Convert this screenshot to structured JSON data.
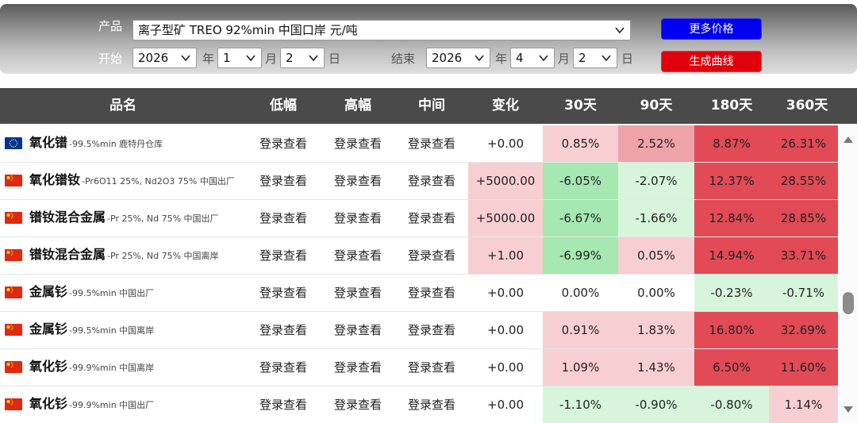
{
  "filters": {
    "product_label": "产品",
    "product_value": "离子型矿 TREO 92%min 中国口岸 元/吨",
    "start_label": "开始",
    "end_label": "结束",
    "year_unit": "年",
    "month_unit": "月",
    "day_unit": "日",
    "start_year": "2026",
    "start_month": "1",
    "start_day": "2",
    "end_year": "2026",
    "end_month": "4",
    "end_day": "2",
    "more_prices_button": "更多价格",
    "generate_curve_button": "生成曲线"
  },
  "table": {
    "headers": [
      "品名",
      "低幅",
      "高幅",
      "中间",
      "变化",
      "30天",
      "90天",
      "180天",
      "360天"
    ],
    "rows": [
      {
        "flag": "eu-flag",
        "name": "氧化镨",
        "spec": "-99.5%min 鹿特丹仓库",
        "low": "登录查看",
        "high": "登录查看",
        "mid": "登录查看",
        "change": "+0.00",
        "d30": "0.85%",
        "d90": "2.52%",
        "d180": "8.87%",
        "d360": "26.31%"
      },
      {
        "flag": "cn-flag",
        "name": "氧化镨钕",
        "spec": "-Pr6O11 25%, Nd2O3 75% 中国出厂",
        "low": "登录查看",
        "high": "登录查看",
        "mid": "登录查看",
        "change": "+5000.00",
        "d30": "-6.05%",
        "d90": "-2.07%",
        "d180": "12.37%",
        "d360": "28.55%"
      },
      {
        "flag": "cn-flag",
        "name": "镨钕混合金属",
        "spec": "-Pr 25%, Nd 75% 中国出厂",
        "low": "登录查看",
        "high": "登录查看",
        "mid": "登录查看",
        "change": "+5000.00",
        "d30": "-6.67%",
        "d90": "-1.66%",
        "d180": "12.84%",
        "d360": "28.85%"
      },
      {
        "flag": "cn-flag",
        "name": "镨钕混合金属",
        "spec": "-Pr 25%, Nd 75% 中国离岸",
        "low": "登录查看",
        "high": "登录查看",
        "mid": "登录查看",
        "change": "+1.00",
        "d30": "-6.99%",
        "d90": "0.05%",
        "d180": "14.94%",
        "d360": "33.71%"
      },
      {
        "flag": "cn-flag",
        "name": "金属钐",
        "spec": "-99.5%min 中国出厂",
        "low": "登录查看",
        "high": "登录查看",
        "mid": "登录查看",
        "change": "+0.00",
        "d30": "0.00%",
        "d90": "0.00%",
        "d180": "-0.23%",
        "d360": "-0.71%"
      },
      {
        "flag": "cn-flag",
        "name": "金属钐",
        "spec": "-99.5%min 中国离岸",
        "low": "登录查看",
        "high": "登录查看",
        "mid": "登录查看",
        "change": "+0.00",
        "d30": "0.91%",
        "d90": "1.83%",
        "d180": "16.80%",
        "d360": "32.69%"
      },
      {
        "flag": "cn-flag",
        "name": "氧化钐",
        "spec": "-99.9%min 中国离岸",
        "low": "登录查看",
        "high": "登录查看",
        "mid": "登录查看",
        "change": "+0.00",
        "d30": "1.09%",
        "d90": "1.43%",
        "d180": "6.50%",
        "d360": "11.60%"
      },
      {
        "flag": "cn-flag",
        "name": "氧化钐",
        "spec": "-99.9%min 中国出厂",
        "low": "登录查看",
        "high": "登录查看",
        "mid": "登录查看",
        "change": "+0.00",
        "d30": "-1.10%",
        "d90": "-0.90%",
        "d180": "-0.80%",
        "d360": "1.14%"
      }
    ]
  },
  "colors": {
    "header_bg": "#4a4a4a",
    "more_prices_bg": "#0000f0",
    "generate_curve_bg": "#e0000d",
    "neutral": "#ffffff",
    "pos_light": "#f7cfd2",
    "pos_mid": "#eea3a9",
    "pos_strong": "#e24a56",
    "neg_light": "#d6f5da",
    "neg_mid": "#a6e8b2",
    "change_pos": "#f7cfd2"
  }
}
